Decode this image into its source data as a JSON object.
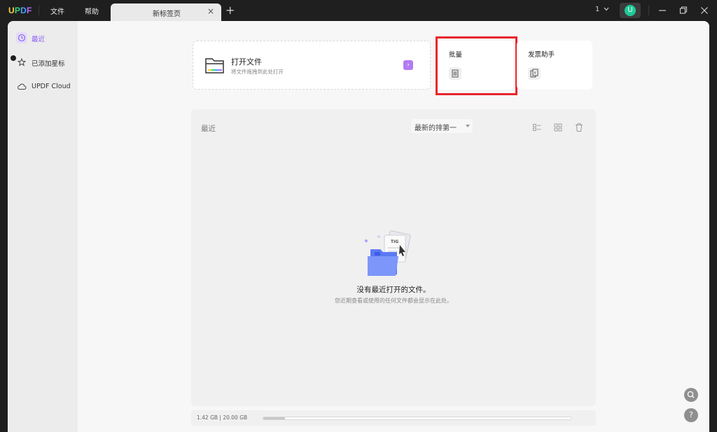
{
  "titlebar": {
    "logo": "UPDF",
    "menu": [
      "文件",
      "帮助"
    ],
    "tab_label": "新标签页",
    "page_indicator": "1",
    "avatar_letter": "U"
  },
  "sidebar": {
    "items": [
      {
        "label": "最近",
        "icon": "clock-icon",
        "active": true
      },
      {
        "label": "已添加星标",
        "icon": "star-icon",
        "active": false
      },
      {
        "label": "UPDF Cloud",
        "icon": "cloud-icon",
        "active": false
      }
    ]
  },
  "open_card": {
    "title": "打开文件",
    "subtitle": "将文件拖拽到此处打开",
    "arrow": "›"
  },
  "tools": {
    "batch_label": "批量",
    "invoice_label": "发票助手"
  },
  "recent": {
    "title": "最近",
    "sort_value": "最新的排第一",
    "empty_title": "没有最近打开的文件。",
    "empty_subtitle": "您近期查看或使用的任何文件都会显示在此处。"
  },
  "status": {
    "storage_text": "1.42 GB | 20.00 GB",
    "storage_fraction": 0.071
  },
  "colors": {
    "accent": "#8a5cf5",
    "highlight": "#e8262c",
    "avatar": "#20c997"
  },
  "floating": {
    "search_icon": "search-icon",
    "help_label": "?"
  }
}
